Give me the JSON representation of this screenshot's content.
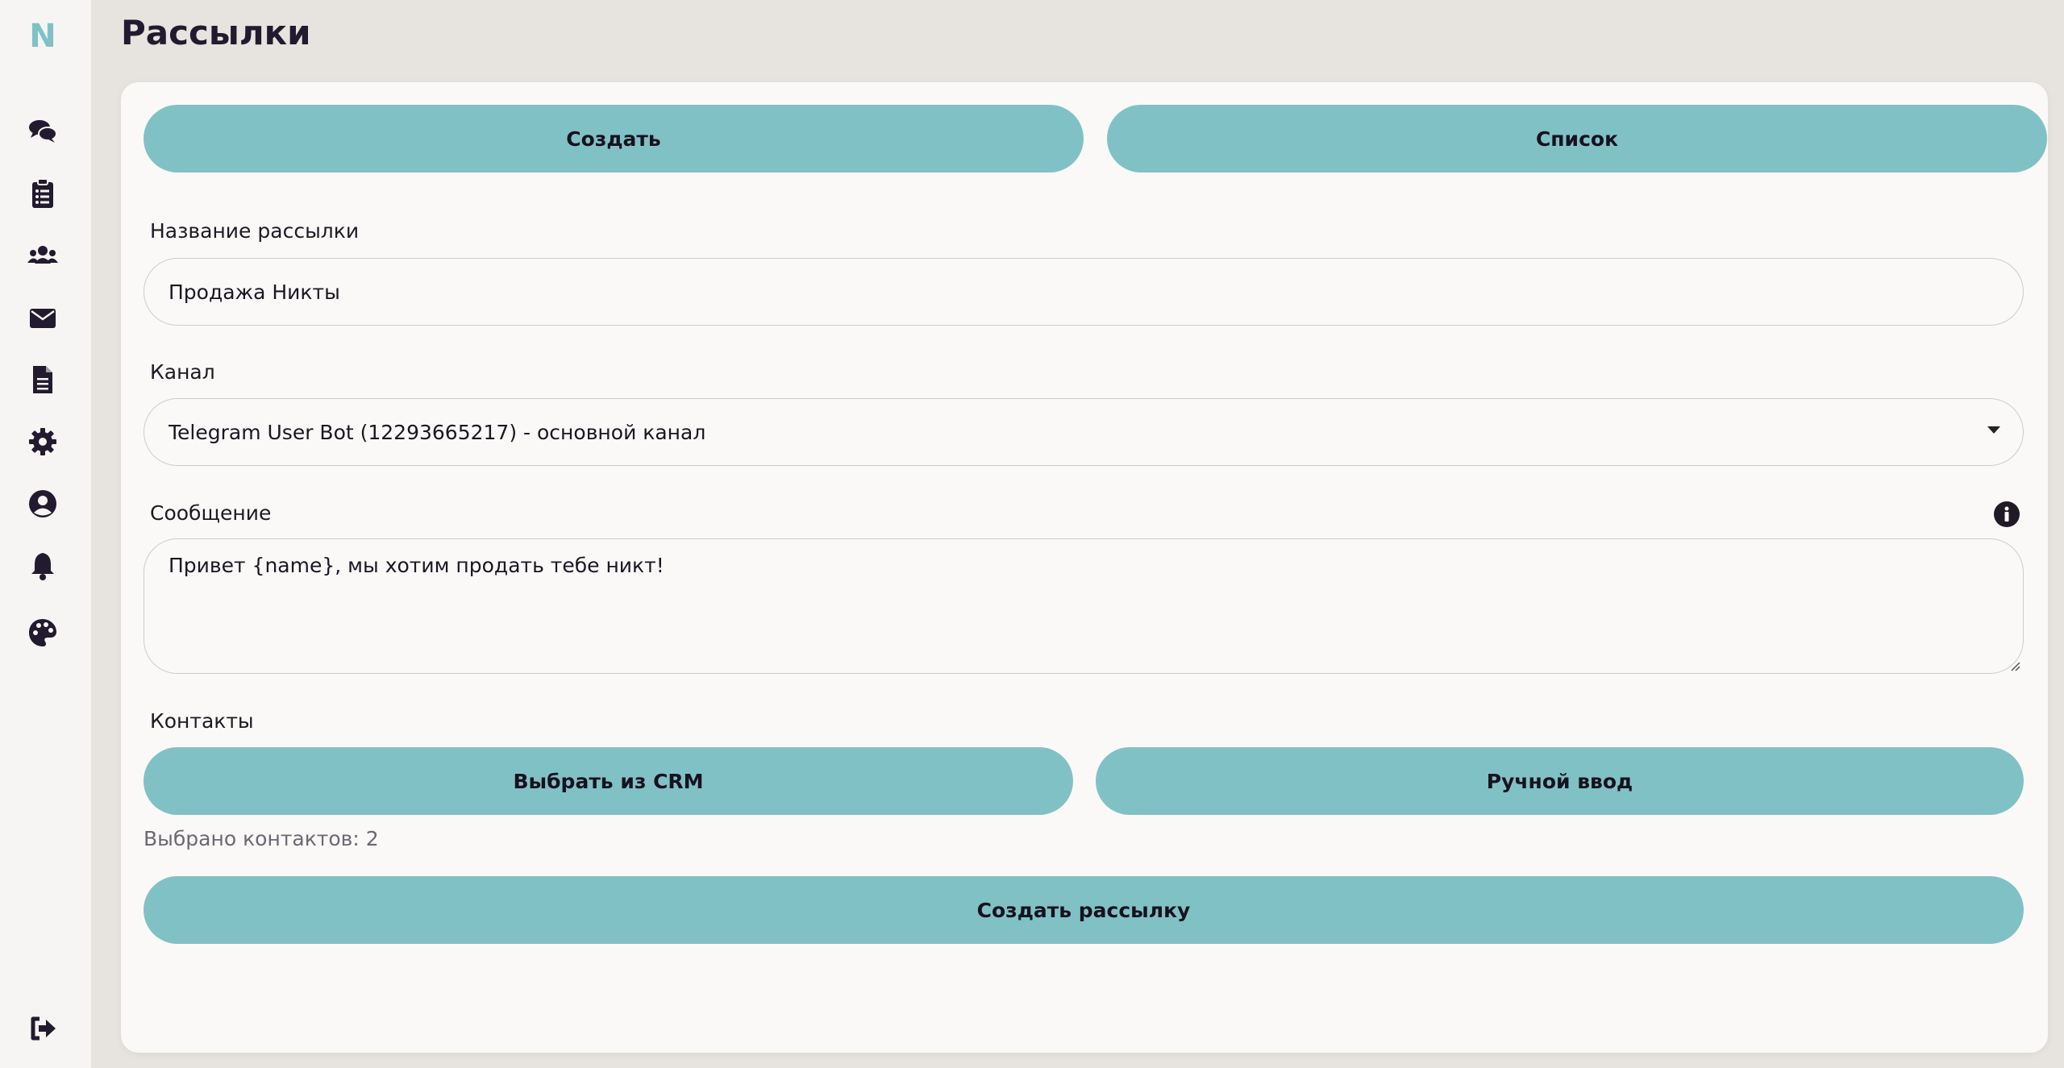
{
  "sidebar": {
    "logo": "N",
    "items": [
      {
        "name": "chats",
        "icon": "chat-bubbles-icon"
      },
      {
        "name": "tasks",
        "icon": "clipboard-list-icon"
      },
      {
        "name": "contacts",
        "icon": "users-icon"
      },
      {
        "name": "mailings",
        "icon": "envelope-icon",
        "active": true
      },
      {
        "name": "documents",
        "icon": "document-icon"
      },
      {
        "name": "settings",
        "icon": "gear-icon"
      },
      {
        "name": "profile",
        "icon": "user-circle-icon"
      },
      {
        "name": "notifications",
        "icon": "bell-icon"
      },
      {
        "name": "theme",
        "icon": "palette-icon"
      }
    ],
    "logout_icon": "logout-icon"
  },
  "page": {
    "title": "Рассылки"
  },
  "tabs": {
    "create_label": "Создать",
    "list_label": "Список"
  },
  "form": {
    "name_label": "Название рассылки",
    "name_value": "Продажа Никты",
    "channel_label": "Канал",
    "channel_value": "Telegram User Bot (12293665217) - основной канал",
    "message_label": "Сообщение",
    "message_value": "Привет {name}, мы хотим продать тебе никт!",
    "contacts_label": "Контакты",
    "pick_crm_label": "Выбрать из CRM",
    "manual_label": "Ручной ввод",
    "selected_count_text": "Выбрано контактов: 2",
    "submit_label": "Создать рассылку"
  },
  "colors": {
    "accent": "#80c1c6",
    "sidebar_bg": "#f7f5f3",
    "page_bg": "#e7e3df",
    "card_bg": "#faf9f8",
    "icon": "#221a2e"
  }
}
